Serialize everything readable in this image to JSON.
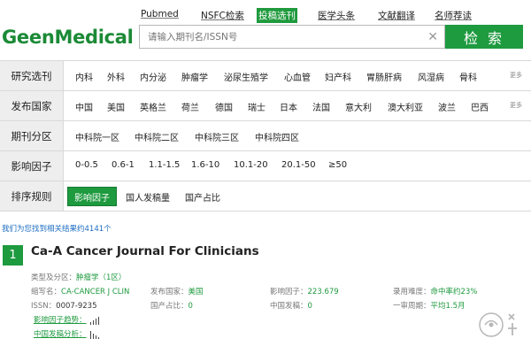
{
  "topnav": {
    "pubmed": "Pubmed",
    "nsfc": "NSFC检索",
    "journal_select": "投稿选刊",
    "med_headlines": "医学头条",
    "translate": "文献翻译",
    "recommend": "名师荐读"
  },
  "logo": "GeenMedical",
  "search": {
    "placeholder": "请输入期刊名/ISSN号",
    "button": "检 索"
  },
  "filters": {
    "research": {
      "label": "研究选刊",
      "options": [
        "内科",
        "外科",
        "内分泌",
        "肿瘤学",
        "泌尿生殖学",
        "心血管",
        "妇产科",
        "胃肠肝病",
        "风湿病",
        "骨科"
      ],
      "more": "更多"
    },
    "country": {
      "label": "发布国家",
      "options": [
        "中国",
        "美国",
        "英格兰",
        "荷兰",
        "德国",
        "瑞士",
        "日本",
        "法国",
        "意大利",
        "澳大利亚",
        "波兰",
        "巴西"
      ],
      "more": "更多"
    },
    "partition": {
      "label": "期刊分区",
      "options": [
        "中科院一区",
        "中科院二区",
        "中科院三区",
        "中科院四区"
      ]
    },
    "impact": {
      "label": "影响因子",
      "options": [
        "0-0.5",
        "0.6-1",
        "1.1-1.5",
        "1.6-10",
        "10.1-20",
        "20.1-50",
        "≥50"
      ]
    },
    "sort": {
      "label": "排序规则",
      "options": [
        "影响因子",
        "国人发稿量",
        "国产占比"
      ]
    }
  },
  "results": {
    "count_text": "我们为您找到相关结果约4141个",
    "first": {
      "rank": "1",
      "title": "Ca-A Cancer Journal For Clinicians",
      "category_k": "类型及分区：",
      "category_v": "肿瘤学（1区）",
      "abbr_k": "缩写名：",
      "abbr_v": "CA-CANCER J CLIN",
      "country_k": "发布国家：",
      "country_v": "美国",
      "if_k": "影响因子：",
      "if_v": "223.679",
      "difficulty_k": "录用难度：",
      "difficulty_v": "命中率约23%",
      "issn_k": "ISSN：",
      "issn_v": "0007-9235",
      "domestic_ratio_k": "国产占比：",
      "domestic_ratio_v": "0",
      "cn_papers_k": "中国发稿：",
      "cn_papers_v": "0",
      "review_k": "一审周期：",
      "review_v": "平均1.5月",
      "trend_if": "影响因子趋势：",
      "trend_cn": "中国发稿分析："
    }
  },
  "colors": {
    "accent": "#1e9a3f",
    "link": "#1c6dc2"
  }
}
